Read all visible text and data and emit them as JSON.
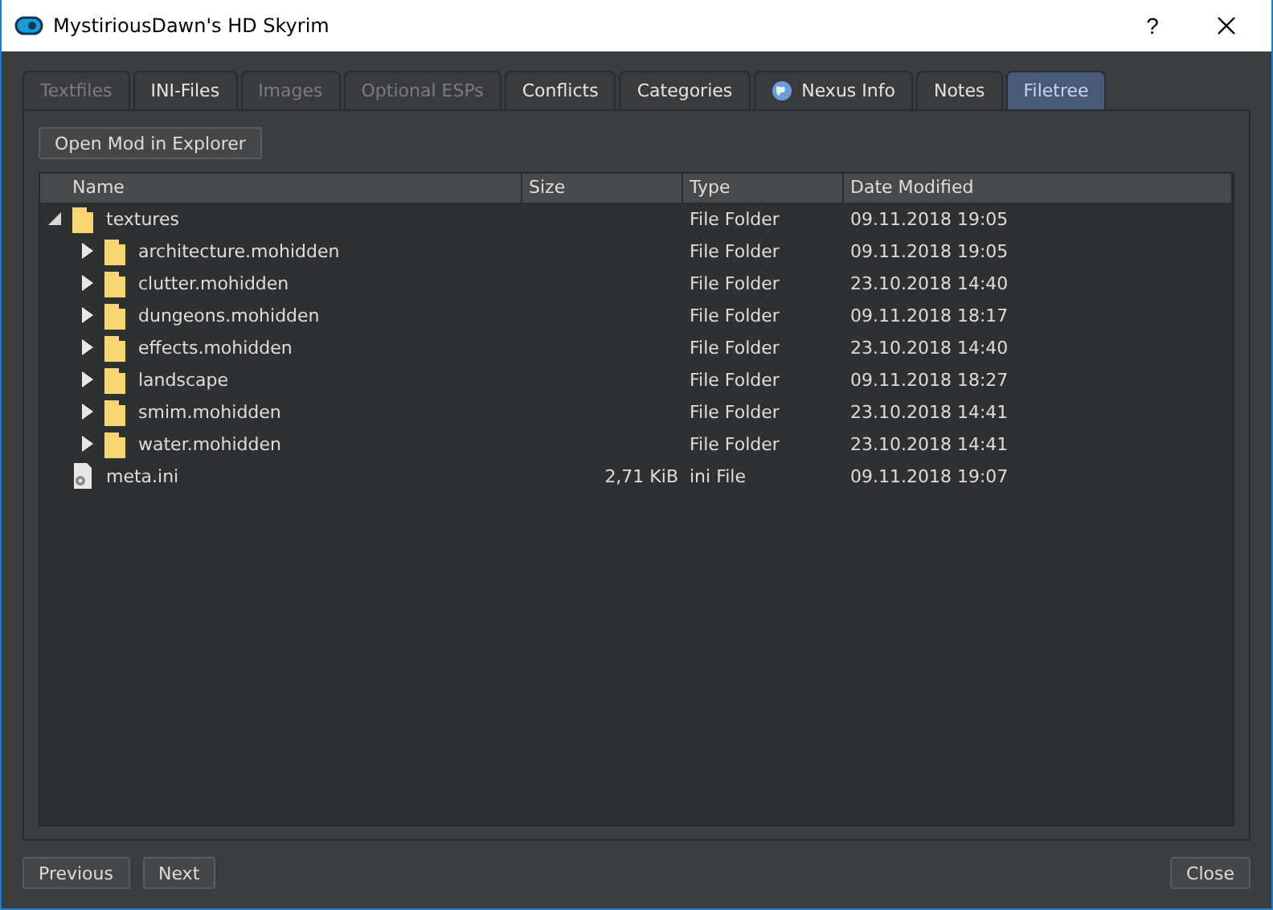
{
  "window": {
    "title": "MystiriousDawn's HD Skyrim",
    "help": "?"
  },
  "tabs": [
    {
      "label": "Textfiles",
      "selected": false,
      "disabled": true
    },
    {
      "label": "INI-Files",
      "selected": false,
      "disabled": false
    },
    {
      "label": "Images",
      "selected": false,
      "disabled": true
    },
    {
      "label": "Optional ESPs",
      "selected": false,
      "disabled": true
    },
    {
      "label": "Conflicts",
      "selected": false,
      "disabled": false
    },
    {
      "label": "Categories",
      "selected": false,
      "disabled": false
    },
    {
      "label": "Nexus Info",
      "selected": false,
      "disabled": false,
      "globe": true
    },
    {
      "label": "Notes",
      "selected": false,
      "disabled": false
    },
    {
      "label": "Filetree",
      "selected": true,
      "disabled": false
    }
  ],
  "open_button": "Open Mod in Explorer",
  "table": {
    "columns": [
      "Name",
      "Size",
      "Type",
      "Date Modified"
    ],
    "rows": [
      {
        "kind": "folder",
        "name": "textures",
        "size": "",
        "type": "File Folder",
        "date": "09.11.2018 19:05",
        "expanded": true,
        "children": [
          {
            "kind": "folder",
            "name": "architecture.mohidden",
            "type": "File Folder",
            "date": "09.11.2018 19:05",
            "expanded": false
          },
          {
            "kind": "folder",
            "name": "clutter.mohidden",
            "type": "File Folder",
            "date": "23.10.2018 14:40",
            "expanded": false
          },
          {
            "kind": "folder",
            "name": "dungeons.mohidden",
            "type": "File Folder",
            "date": "09.11.2018 18:17",
            "expanded": false
          },
          {
            "kind": "folder",
            "name": "effects.mohidden",
            "type": "File Folder",
            "date": "23.10.2018 14:40",
            "expanded": false
          },
          {
            "kind": "folder",
            "name": "landscape",
            "type": "File Folder",
            "date": "09.11.2018 18:27",
            "expanded": false
          },
          {
            "kind": "folder",
            "name": "smim.mohidden",
            "type": "File Folder",
            "date": "23.10.2018 14:41",
            "expanded": false
          },
          {
            "kind": "folder",
            "name": "water.mohidden",
            "type": "File Folder",
            "date": "23.10.2018 14:41",
            "expanded": false
          }
        ]
      },
      {
        "kind": "file",
        "name": "meta.ini",
        "size": "2,71 KiB",
        "type": "ini File",
        "date": "09.11.2018 19:07"
      }
    ]
  },
  "buttons": {
    "previous": "Previous",
    "next": "Next",
    "close": "Close"
  }
}
